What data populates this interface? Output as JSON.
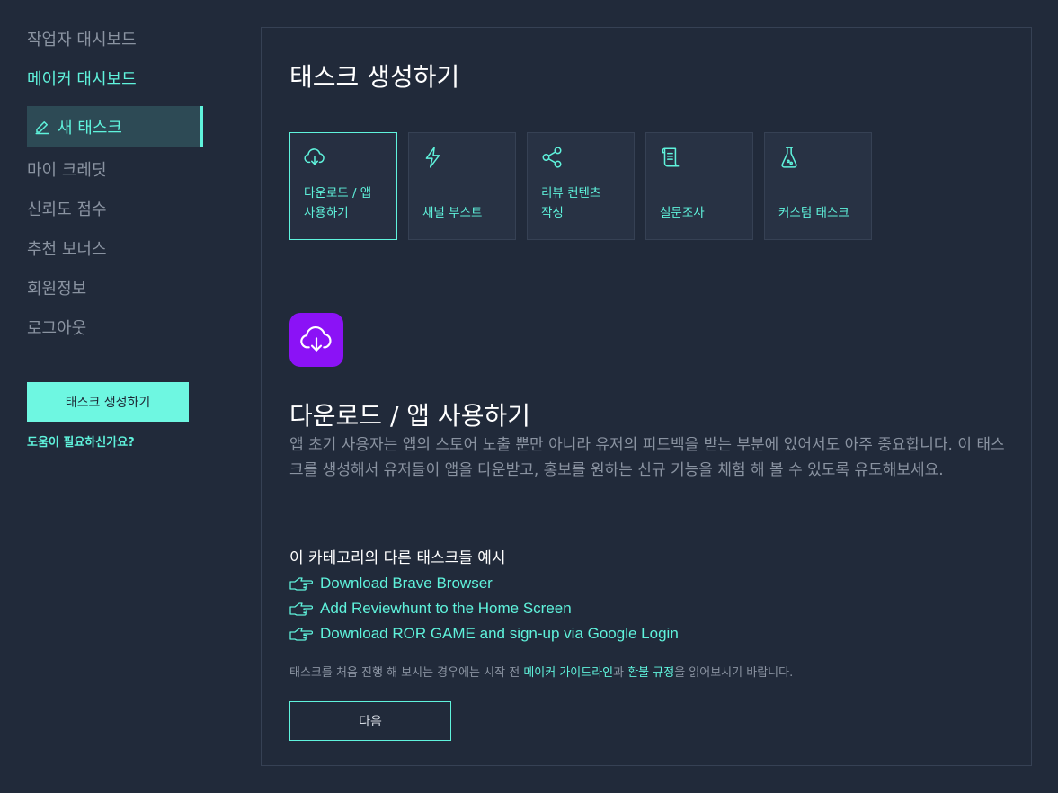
{
  "sidebar": {
    "items": [
      {
        "label": "작업자 대시보드"
      },
      {
        "label": "메이커 대시보드"
      },
      {
        "label": "새 태스크"
      },
      {
        "label": "마이 크레딧"
      },
      {
        "label": "신뢰도 점수"
      },
      {
        "label": "추천 보너스"
      },
      {
        "label": "회원정보"
      },
      {
        "label": "로그아웃"
      }
    ],
    "create_button": "태스크 생성하기",
    "help_link": "도움이 필요하신가요?"
  },
  "main": {
    "title": "태스크 생성하기",
    "categories": [
      {
        "label": "다운로드 / 앱\n사용하기",
        "icon": "cloud-download-icon",
        "selected": true
      },
      {
        "label": "채널 부스트",
        "icon": "lightning-icon",
        "selected": false
      },
      {
        "label": "리뷰 컨텐츠\n작성",
        "icon": "share-icon",
        "selected": false
      },
      {
        "label": "설문조사",
        "icon": "scroll-icon",
        "selected": false
      },
      {
        "label": "커스텀 태스크",
        "icon": "flask-icon",
        "selected": false
      }
    ],
    "section_icon": "cloud-download-icon",
    "section_title": "다운로드 / 앱 사용하기",
    "description": "앱 초기 사용자는 앱의 스토어 노출 뿐만 아니라 유저의 피드백을 받는 부분에 있어서도 아주 중요합니다. 이 태스크를 생성해서 유저들이 앱을 다운받고, 홍보를 원하는 신규 기능을 체험 해 볼 수 있도록 유도해보세요.",
    "examples_title": "이 카테고리의 다른 태스크들 예시",
    "examples": [
      "Download Brave Browser",
      "Add Reviewhunt to the Home Screen",
      "Download ROR GAME and sign-up via Google Login"
    ],
    "note": {
      "prefix": "태스크를 처음 진행 해 보시는 경우에는 시작 전 ",
      "link1": "메이커 가이드라인",
      "middle": "과 ",
      "link2": "환불 규정",
      "suffix": "을 읽어보시기 바랍니다."
    },
    "next_button": "다음"
  },
  "colors": {
    "background": "#212a3a",
    "accent": "#5ff3dc",
    "icon_bg": "#8b12f6",
    "muted_text": "#8a93a1"
  }
}
